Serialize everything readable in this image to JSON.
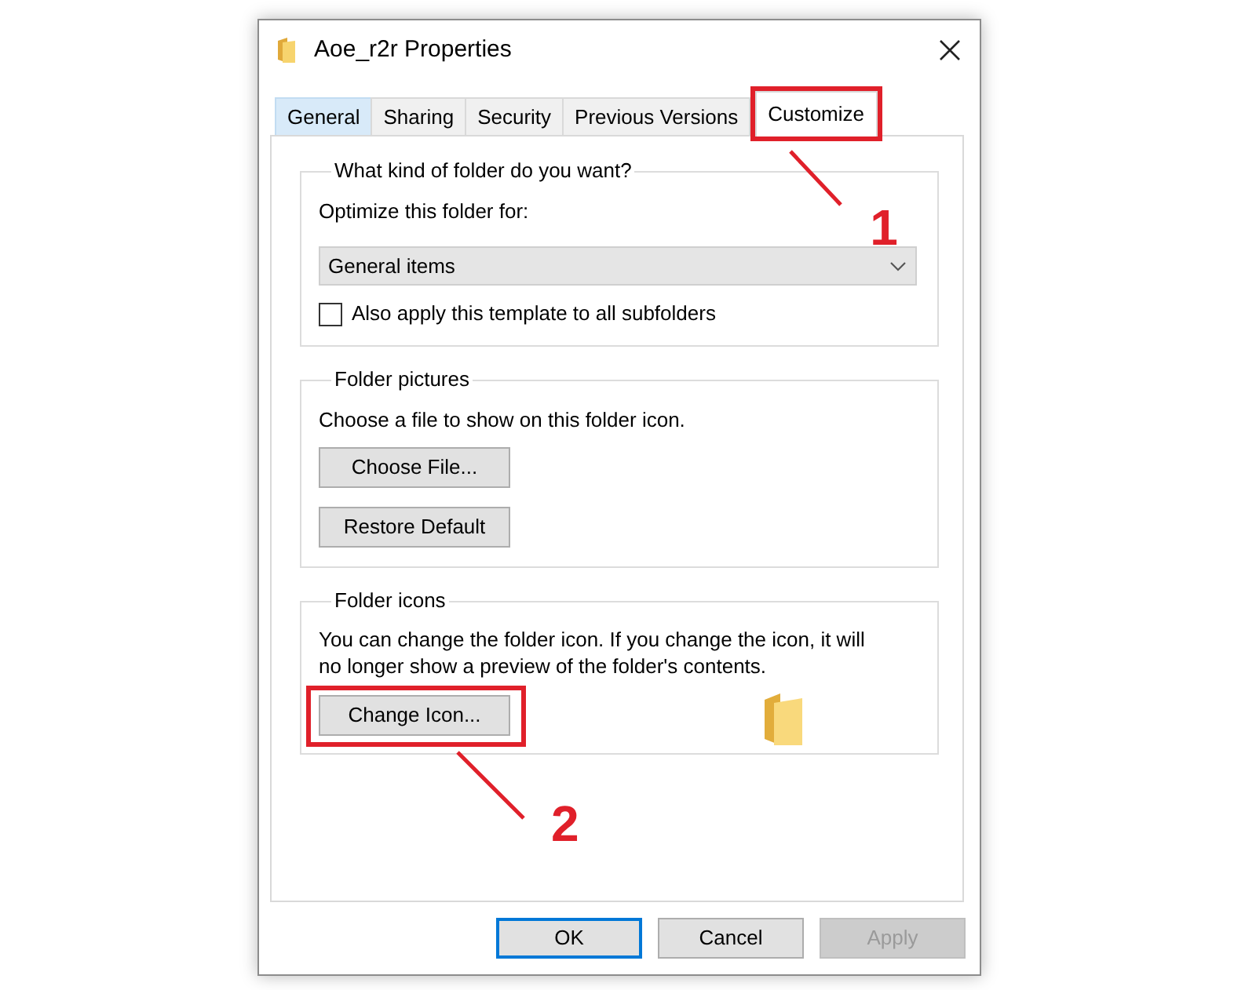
{
  "window": {
    "title": "Aoe_r2r Properties"
  },
  "tabs": [
    {
      "label": "General",
      "selected": false,
      "hovered": true
    },
    {
      "label": "Sharing",
      "selected": false,
      "hovered": false
    },
    {
      "label": "Security",
      "selected": false,
      "hovered": false
    },
    {
      "label": "Previous Versions",
      "selected": false,
      "hovered": false
    },
    {
      "label": "Customize",
      "selected": true,
      "hovered": false,
      "callout": "1"
    }
  ],
  "groups": [
    {
      "kind": "template",
      "title": "What kind of folder do you want?",
      "label": "Optimize this folder for:",
      "dropdown": {
        "value": "General items"
      },
      "checkbox": {
        "label": "Also apply this template to all subfolders",
        "checked": false
      }
    },
    {
      "kind": "picture",
      "title": "Folder pictures",
      "text": "Choose a file to show on this folder icon.",
      "buttons": [
        {
          "label": "Choose File..."
        },
        {
          "label": "Restore Default"
        }
      ]
    },
    {
      "kind": "icon",
      "title": "Folder icons",
      "text": "You can change the folder icon. If you change the icon, it will no longer show a preview of the folder's contents.",
      "buttons": [
        {
          "label": "Change Icon...",
          "callout": "2"
        }
      ]
    }
  ],
  "footer_buttons": [
    {
      "label": "OK",
      "default": true,
      "disabled": false
    },
    {
      "label": "Cancel",
      "default": false,
      "disabled": false
    },
    {
      "label": "Apply",
      "default": false,
      "disabled": true
    }
  ]
}
